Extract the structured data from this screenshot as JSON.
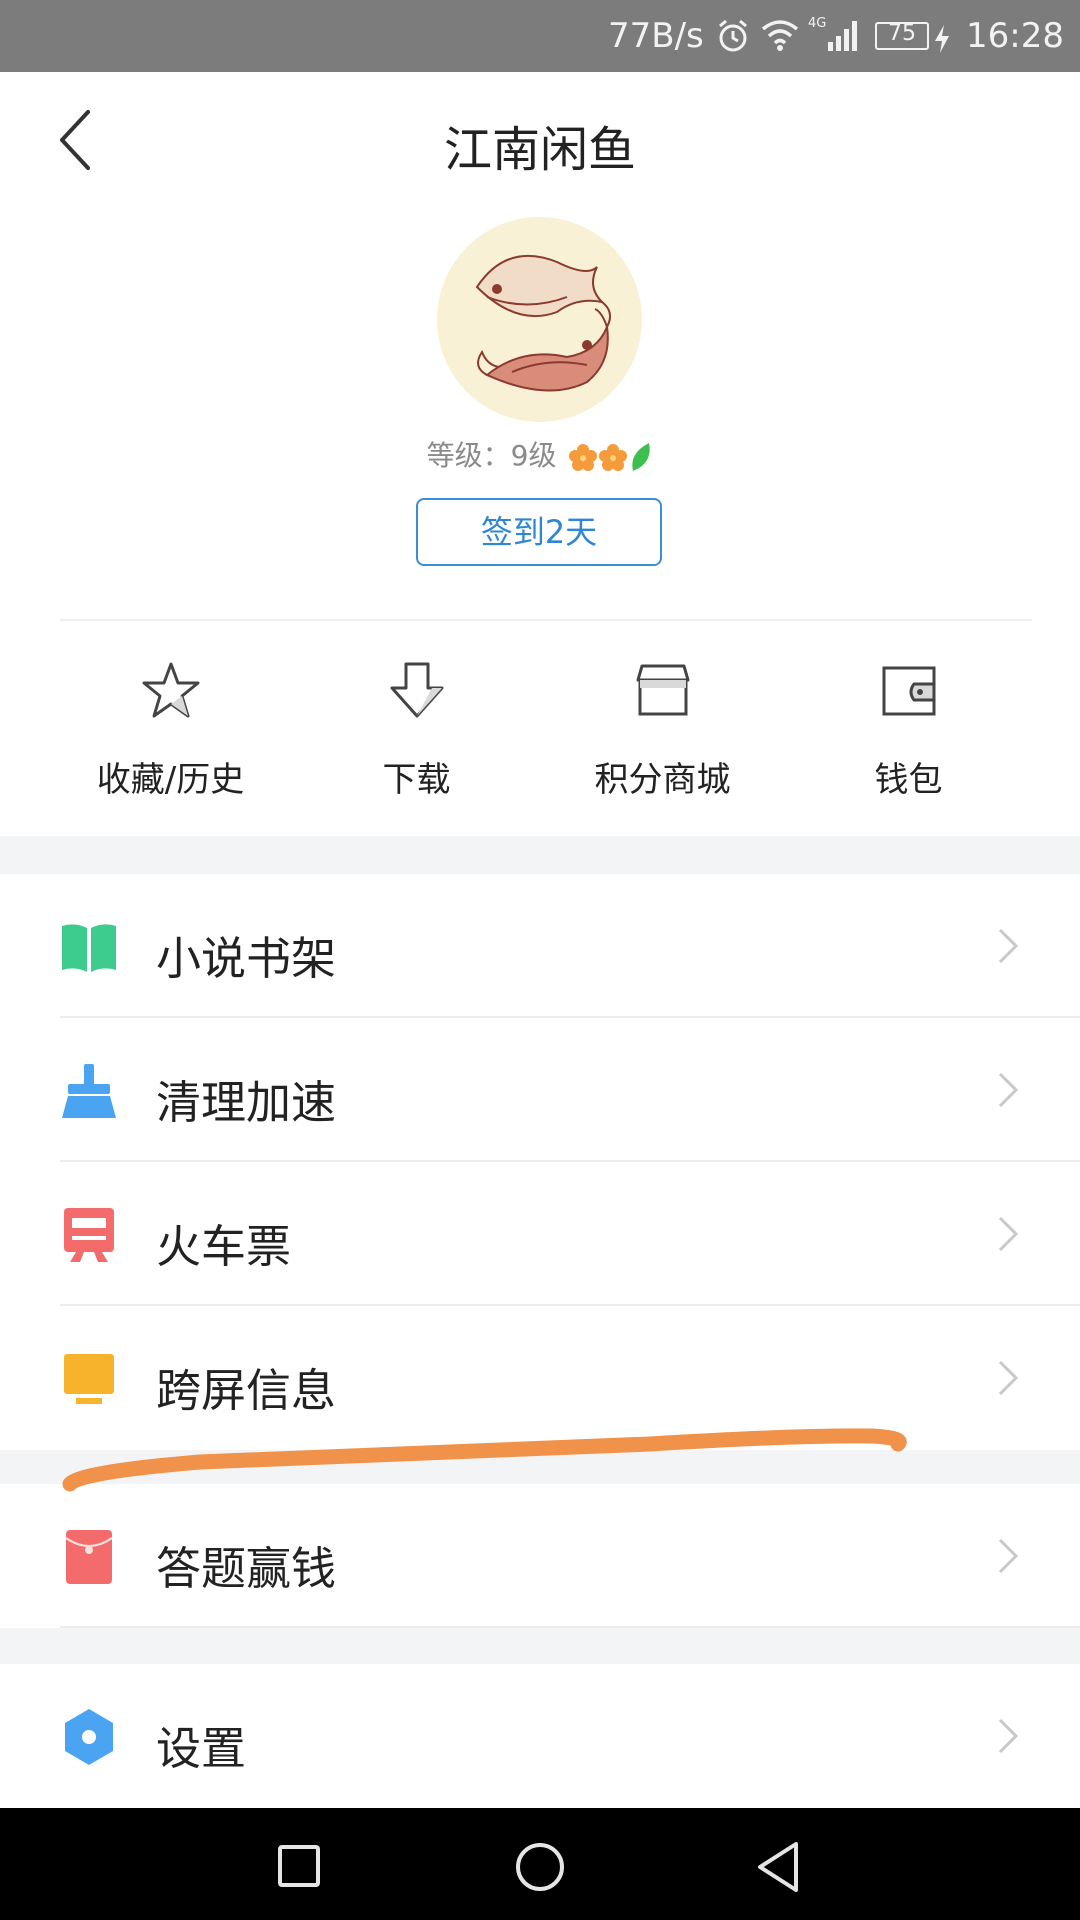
{
  "status_bar": {
    "net_speed": "77B/s",
    "network_type": "4G",
    "battery": "75",
    "time": "16:28"
  },
  "header": {
    "title": "江南闲鱼",
    "back_icon": "chevron-left-icon"
  },
  "profile": {
    "level_text": "等级：9级",
    "checkin_label": "签到2天"
  },
  "quick_actions": [
    {
      "label": "收藏/历史",
      "icon": "star-icon"
    },
    {
      "label": "下载",
      "icon": "download-icon"
    },
    {
      "label": "积分商城",
      "icon": "store-icon"
    },
    {
      "label": "钱包",
      "icon": "wallet-icon"
    }
  ],
  "menu": [
    {
      "label": "小说书架",
      "icon": "book-icon",
      "color": "#3dcc8e"
    },
    {
      "label": "清理加速",
      "icon": "broom-icon",
      "color": "#4ba4f2"
    },
    {
      "label": "火车票",
      "icon": "train-icon",
      "color": "#f46b6b"
    },
    {
      "label": "跨屏信息",
      "icon": "monitor-icon",
      "color": "#f7b32b"
    },
    {
      "label": "答题赢钱",
      "icon": "red-envelope-icon",
      "color": "#f46b6b"
    },
    {
      "label": "设置",
      "icon": "settings-icon",
      "color": "#4ba4f2"
    }
  ],
  "colors": {
    "accent_blue": "#2f86d4",
    "annotation_orange": "#f0924a"
  }
}
